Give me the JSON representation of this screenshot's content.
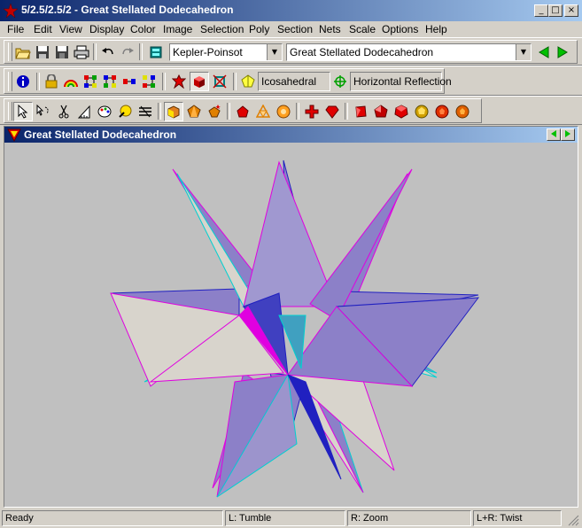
{
  "window": {
    "title": "5/2.5/2.5/2 - Great Stellated Dodecahedron"
  },
  "window_controls": {
    "minimize": "_",
    "maximize": "□",
    "close": "×"
  },
  "menu": [
    "File",
    "Edit",
    "View",
    "Display",
    "Color",
    "Image",
    "Selection",
    "Poly",
    "Section",
    "Nets",
    "Scale",
    "Options",
    "Help"
  ],
  "toolbar1": {
    "family_select": "Kepler-Poinsot",
    "poly_select": "Great Stellated Dodecahedron",
    "icons": [
      "open-icon",
      "save-icon",
      "save-as-icon",
      "print-icon",
      "undo-icon",
      "redo-icon",
      "database-icon",
      "prev-arrow-icon",
      "next-arrow-icon"
    ]
  },
  "toolbar2": {
    "symmetry_label": "Icosahedral",
    "reflection_label": "Horizontal Reflection",
    "icons": [
      "info-icon",
      "lock-icon",
      "rainbow-icon",
      "graph-a-icon",
      "graph-b-icon",
      "graph-c-icon",
      "graph-d-icon",
      "red-star-icon",
      "red-cube-icon",
      "compound-icon",
      "symmetry-icon",
      "reflection-icon"
    ]
  },
  "toolbar3": {
    "icons": [
      "select-arrow-icon",
      "lasso-icon",
      "scissors-icon",
      "ruler-icon",
      "palette-icon",
      "morph-icon",
      "stripes-icon",
      "solid-face-icon",
      "orange-poly-icon",
      "sparkle-poly-icon",
      "pentagon-icon",
      "net-icon",
      "orange-ball-icon",
      "cross-icon",
      "truncate-icon",
      "red-solid-a-icon",
      "red-solid-b-icon",
      "red-solid-c-icon",
      "red-solid-d-icon",
      "red-solid-e-icon",
      "red-solid-f-icon"
    ]
  },
  "document": {
    "title": "Great Stellated Dodecahedron"
  },
  "status": {
    "ready": "Ready",
    "left": "L: Tumble",
    "right": "R: Zoom",
    "both": "L+R: Twist"
  },
  "colors": {
    "title_start": "#0a246a",
    "title_end": "#a6caf0",
    "canvas": "#c0c0c0",
    "face_light": "#d8d4cc",
    "face_purple": "#8c80c8",
    "edge_magenta": "#e000e0",
    "edge_cyan": "#00d0d0",
    "edge_blue": "#2020c0"
  }
}
